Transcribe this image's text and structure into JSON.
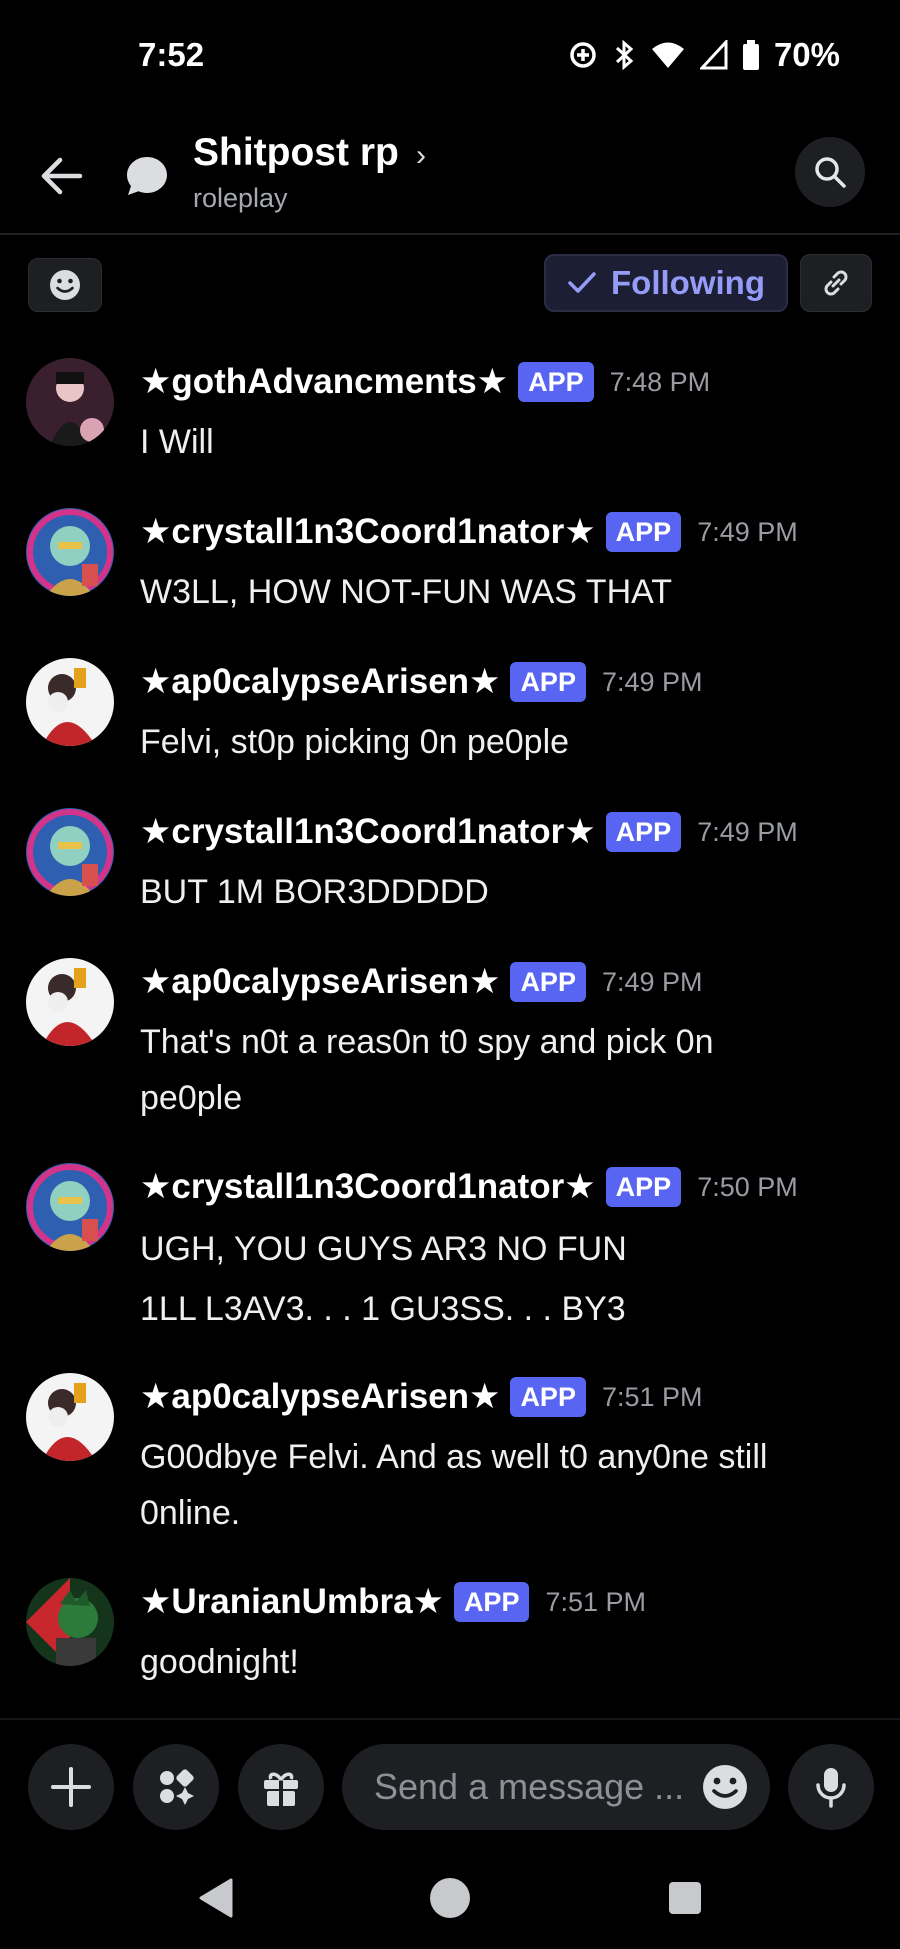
{
  "status_bar": {
    "time": "7:52",
    "battery_percent": "70%"
  },
  "header": {
    "title": "Shitpost rp",
    "subtitle": "roleplay",
    "chevron": "›"
  },
  "toolbar": {
    "following_label": "Following"
  },
  "messages": [
    {
      "username": "★gothAdvancments★",
      "badge": "APP",
      "time": "7:48 PM",
      "lines": [
        "I Will"
      ]
    },
    {
      "username": "★crystall1n3Coord1nator★",
      "badge": "APP",
      "time": "7:49 PM",
      "lines": [
        "W3LL, HOW NOT-FUN WAS THAT"
      ]
    },
    {
      "username": "★ap0calypseArisen★",
      "badge": "APP",
      "time": "7:49 PM",
      "lines": [
        "Felvi, st0p picking 0n pe0ple"
      ]
    },
    {
      "username": "★crystall1n3Coord1nator★",
      "badge": "APP",
      "time": "7:49 PM",
      "lines": [
        "BUT 1M BOR3DDDDD"
      ]
    },
    {
      "username": "★ap0calypseArisen★",
      "badge": "APP",
      "time": "7:49 PM",
      "lines": [
        "That's n0t a reas0n t0 spy and pick 0n",
        "pe0ple"
      ]
    },
    {
      "username": "★crystall1n3Coord1nator★",
      "badge": "APP",
      "time": "7:50 PM",
      "lines": [
        "UGH, YOU GUYS AR3 NO FUN",
        "1LL L3AV3. . . 1 GU3SS. . . BY3"
      ]
    },
    {
      "username": "★ap0calypseArisen★",
      "badge": "APP",
      "time": "7:51 PM",
      "lines": [
        "G00dbye Felvi. And as well t0 any0ne still",
        "0nline."
      ]
    },
    {
      "username": "★UranianUmbra★",
      "badge": "APP",
      "time": "7:51 PM",
      "lines": [
        "goodnight!"
      ]
    }
  ],
  "composer": {
    "placeholder": "Send a message ..."
  },
  "icons": {
    "status": [
      "data-saver-icon",
      "bluetooth-icon",
      "wifi-icon",
      "signal-icon",
      "battery-icon"
    ],
    "header": [
      "back-arrow-icon",
      "thread-icon",
      "search-icon"
    ],
    "toolbar": [
      "emoji-icon",
      "checkmark-icon",
      "link-icon"
    ],
    "composer": [
      "plus-icon",
      "apps-icon",
      "gift-icon",
      "emoji-icon",
      "microphone-icon"
    ],
    "nav": [
      "back-triangle-icon",
      "home-circle-icon",
      "recents-square-icon"
    ]
  },
  "colors": {
    "accent": "#5865f2",
    "following_text": "#949cf7",
    "background": "#000000"
  }
}
